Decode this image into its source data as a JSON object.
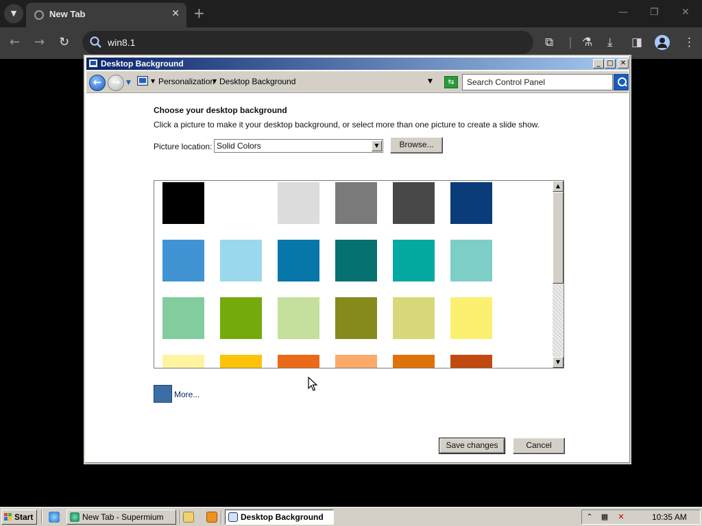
{
  "browser": {
    "tab_title": "New Tab",
    "address": "win8.1"
  },
  "dialog": {
    "title": "Desktop Background",
    "breadcrumb": [
      "Personalization",
      "Desktop Background"
    ],
    "search_placeholder": "Search Control Panel",
    "heading": "Choose your desktop background",
    "description": "Click a picture to make it your desktop background, or select more than one picture to create a slide show.",
    "picture_location_label": "Picture location:",
    "picture_location_value": "Solid Colors",
    "browse_label": "Browse...",
    "more_label": "More...",
    "more_color": "#3a6ea5",
    "save_label": "Save changes",
    "cancel_label": "Cancel",
    "swatches": [
      [
        "#000000",
        "#ffffff",
        "#dcdcdc",
        "#7a7a7a",
        "#484848",
        "#0a3c7a"
      ],
      [
        "#4094d4",
        "#9ad8ec",
        "#0677a8",
        "#077070",
        "#04aaa2",
        "#7ecec8"
      ],
      [
        "#82cc9e",
        "#74aa0c",
        "#c4e09c",
        "#868a1c",
        "#d8d87a",
        "#fcf070"
      ],
      [
        "#fff3a0",
        "#fcc30a",
        "#ea6a1a",
        "#fbaa6a",
        "#e0720a",
        "#c04a10"
      ]
    ]
  },
  "taskbar": {
    "start_label": "Start",
    "tasks": [
      "New Tab - Supermium",
      "Desktop Background"
    ],
    "clock": "10:35 AM"
  }
}
